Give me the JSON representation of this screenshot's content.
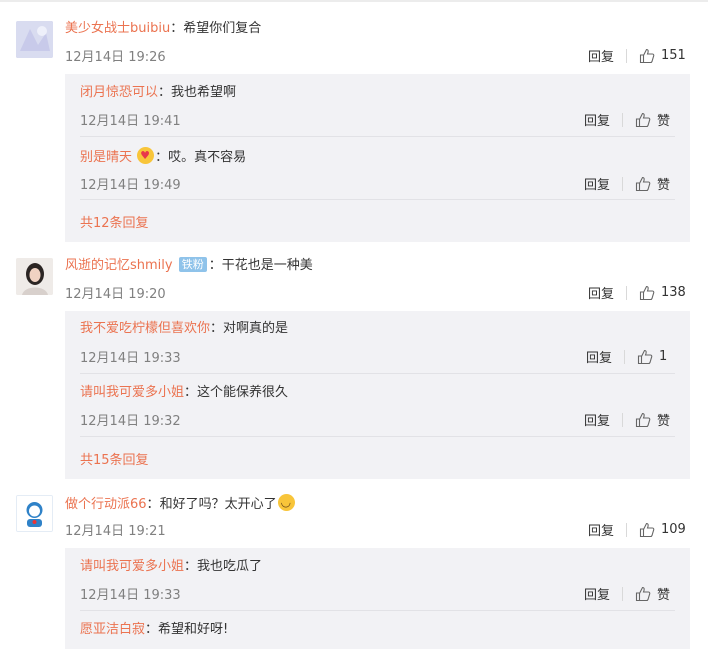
{
  "actions": {
    "reply_label": "回复",
    "like_label": "赞"
  },
  "comments": [
    {
      "user": "美少女战士buibiu",
      "sep": "：",
      "text": "希望你们复合",
      "time": "12月14日 19:26",
      "likes": "151",
      "replies": [
        {
          "user": "闭月惊恐可以",
          "sep": "：",
          "text": "我也希望啊",
          "time": "12月14日 19:41",
          "likes": "赞"
        },
        {
          "user": "别是晴天",
          "sep": "：",
          "text": "哎。真不容易",
          "time": "12月14日 19:49",
          "likes": "赞"
        }
      ],
      "more": "共12条回复"
    },
    {
      "user": "风逝的记忆shmily",
      "badge": "铁粉",
      "sep": "：",
      "text": "干花也是一种美",
      "time": "12月14日 19:20",
      "likes": "138",
      "replies": [
        {
          "user": "我不爱吃柠檬但喜欢你",
          "sep": "：",
          "text": "对啊真的是",
          "time": "12月14日 19:33",
          "likes": "1"
        },
        {
          "user": "请叫我可爱多小姐",
          "sep": "：",
          "text": "这个能保养很久",
          "time": "12月14日 19:32",
          "likes": "赞"
        }
      ],
      "more": "共15条回复"
    },
    {
      "user": "做个行动派66",
      "sep": "：",
      "text": "和好了吗？太开心了",
      "time": "12月14日 19:21",
      "likes": "109",
      "replies": [
        {
          "user": "请叫我可爱多小姐",
          "sep": "：",
          "text": "我也吃瓜了",
          "time": "12月14日 19:33",
          "likes": "赞"
        },
        {
          "user": "愿亚洁白寂",
          "sep": "：",
          "text": "希望和好呀!"
        }
      ]
    }
  ]
}
